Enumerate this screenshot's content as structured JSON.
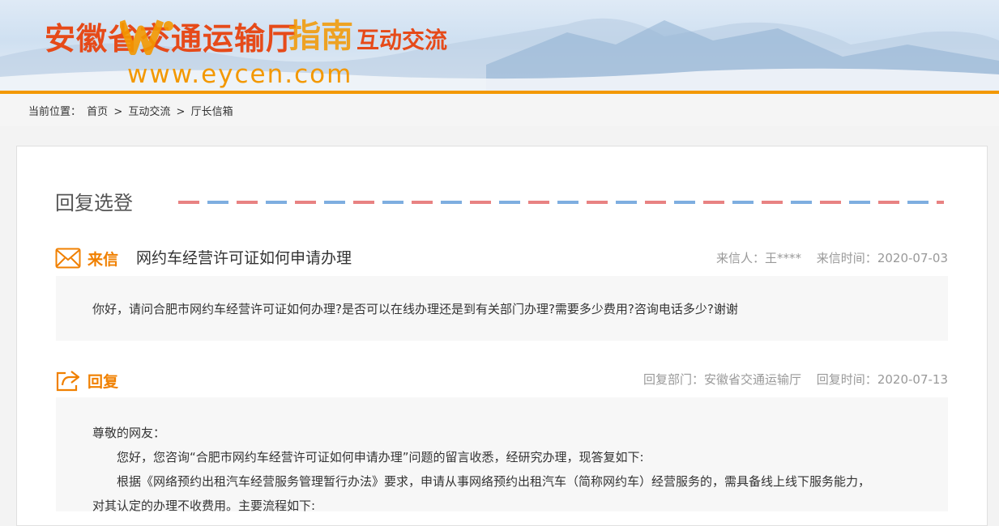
{
  "banner": {
    "site_title": "安徽省交通运输厅",
    "section_title": "互动交流",
    "watermark_text": "指南",
    "watermark_url": "www.eycen.com"
  },
  "breadcrumb": {
    "prefix": "当前位置：",
    "items": [
      "首页",
      "互动交流",
      "厅长信箱"
    ],
    "separator": ">"
  },
  "page": {
    "heading": "回复选登"
  },
  "letter": {
    "label": "来信",
    "subject": "网约车经营许可证如何申请办理",
    "sender_label": "来信人：",
    "sender": "王****",
    "date_label": "来信时间：",
    "date": "2020-07-03",
    "body": "你好，请问合肥市网约车经营许可证如何办理?是否可以在线办理还是到有关部门办理?需要多少费用?咨询电话多少?谢谢"
  },
  "reply": {
    "label": "回复",
    "dept_label": "回复部门：",
    "dept": "安徽省交通运输厅",
    "date_label": "回复时间：",
    "date": "2020-07-13",
    "lines": [
      "尊敬的网友：",
      "　　您好，您咨询“合肥市网约车经营许可证如何申请办理”问题的留言收悉，经研究办理，现答复如下:",
      "　　根据《网络预约出租汽车经营服务管理暂行办法》要求，申请从事网络预约出租汽车（简称网约车）经营服务的，需具备线上线下服务能力，",
      "对其认定的办理不收费用。主要流程如下:"
    ]
  },
  "colors": {
    "accent": "#f08000",
    "banner_line": "#f39800",
    "title_red": "#e64a19",
    "dash_red": "#e88282",
    "dash_blue": "#7eaee0"
  },
  "icons": {
    "letter": "envelope-icon",
    "reply": "share-arrow-icon"
  }
}
